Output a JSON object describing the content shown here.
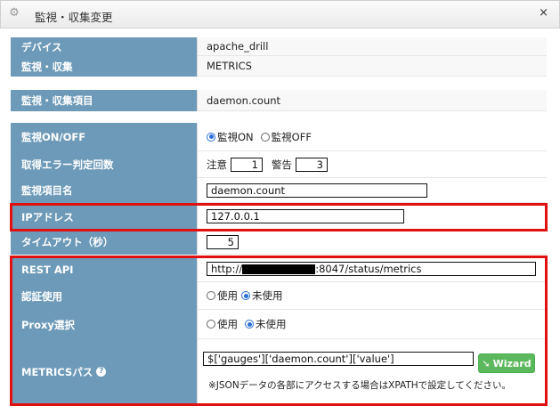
{
  "window": {
    "title": "監視・収集変更"
  },
  "info": {
    "device_label": "デバイス",
    "device_value": "apache_drill",
    "monitor_label": "監視・収集",
    "monitor_value": "METRICS",
    "item_label": "監視・収集項目",
    "item_value": "daemon.count"
  },
  "form": {
    "onoff_label": "監視ON/OFF",
    "on_label": "監視ON",
    "off_label": "監視OFF",
    "onoff_selected": "on",
    "error_label": "取得エラー判定回数",
    "warn_label": "注意",
    "warn_value": "1",
    "crit_label": "警告",
    "crit_value": "3",
    "item_name_label": "監視項目名",
    "item_name_value": "daemon.count",
    "ip_label": "IPアドレス",
    "ip_value": "127.0.0.1",
    "timeout_label": "タイムアウト（秒）",
    "timeout_value": "5",
    "rest_label": "REST API",
    "rest_prefix": "http://",
    "rest_suffix": ":8047/status/metrics",
    "auth_label": "認証使用",
    "auth_use": "使用",
    "auth_nouse": "未使用",
    "auth_selected": "nouse",
    "proxy_label": "Proxy選択",
    "proxy_use": "使用",
    "proxy_nouse": "未使用",
    "proxy_selected": "nouse",
    "path_label": "METRICSパス",
    "path_value": "$['gauges']['daemon.count']['value']",
    "wizard_label": "Wizard",
    "note": "※JSONデータの各部にアクセスする場合はXPATHで設定してください。"
  },
  "colors": {
    "label_bg": "#6d9ab8",
    "highlight": "#e01010",
    "wizard_bg": "#5cb85c"
  },
  "icons": {
    "title": "gear-icon",
    "close": "close-icon",
    "wizard": "wand-icon",
    "help": "help-icon"
  }
}
